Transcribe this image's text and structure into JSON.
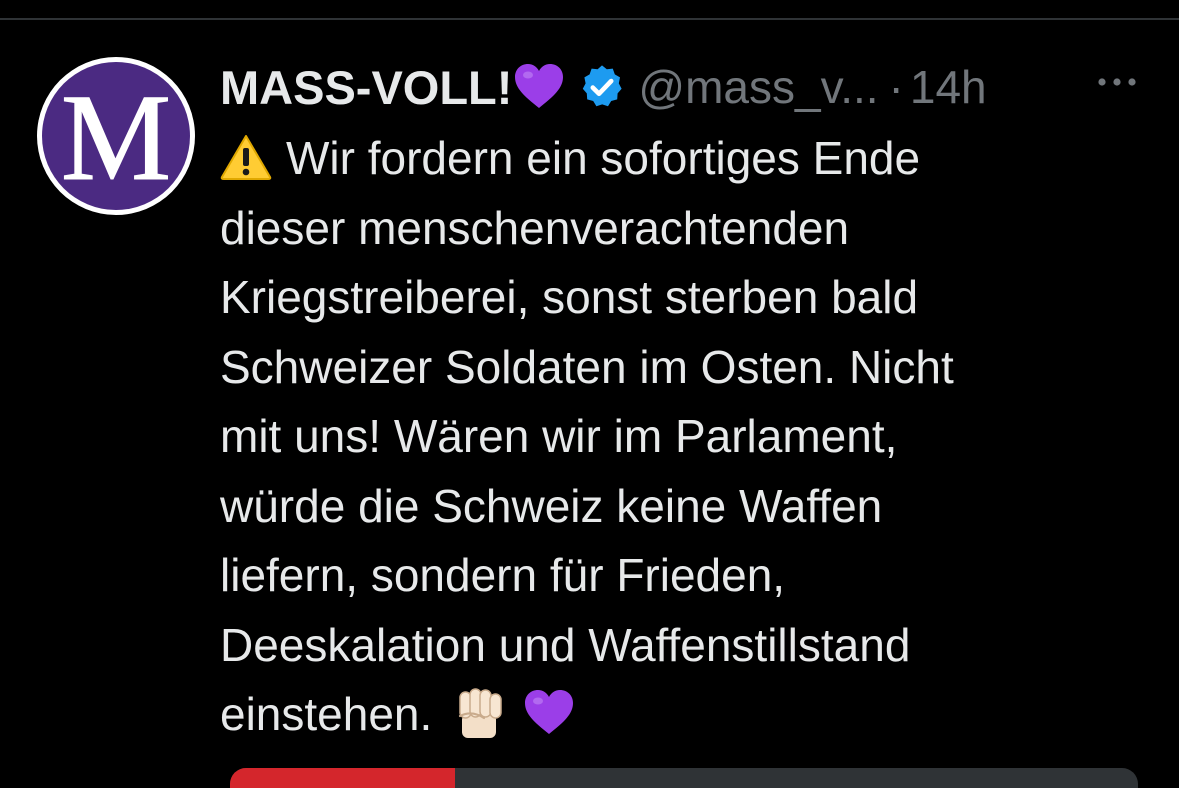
{
  "tweet": {
    "avatar_letter": "M",
    "display_name": "MASS-VOLL!",
    "handle": "@mass_v...",
    "separator": "·",
    "time": "14h",
    "text_lines": [
      "Wir fordern ein sofortiges Ende",
      "dieser menschenverachtenden",
      "Kriegstreiberei, sonst sterben bald",
      "Schweizer Soldaten im Osten. Nicht",
      "mit uns! Wären wir im Parlament,",
      "würde die Schweiz keine Waffen",
      "liefern, sondern für Frieden,",
      "Deeskalation und Waffenstillstand",
      "einstehen."
    ],
    "icons": {
      "name_emoji": "purple-heart-icon",
      "badge": "verified-badge-icon",
      "menu": "more-options-icon",
      "text_start": "warning-icon",
      "text_end": [
        "raised-fist-icon",
        "purple-heart-icon"
      ]
    }
  },
  "colors": {
    "background": "#000000",
    "text_primary": "#e7e9ea",
    "text_secondary": "#71767b",
    "verified_blue": "#1d9bf0",
    "avatar_purple": "#4b2a82",
    "heart_purple": "#9b3ee8",
    "warning_yellow": "#ffcc33",
    "divider": "#2f3336"
  }
}
